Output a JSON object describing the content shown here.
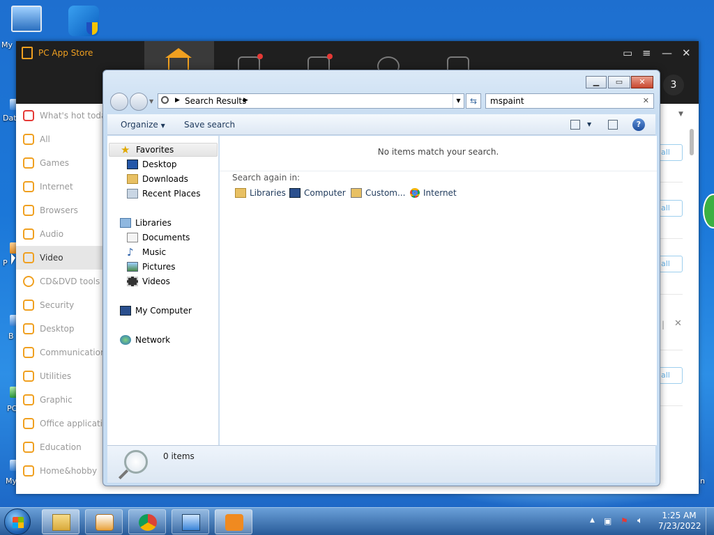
{
  "desktop": {
    "icon_my_computer_label": "My",
    "partial_labels": [
      "Dat",
      "P",
      "B",
      "PC",
      "My"
    ],
    "right_edge_label": "n"
  },
  "app_store": {
    "title": "PC App Store",
    "notification_count": "3",
    "sidebar": [
      {
        "label": "What's hot toda",
        "icon": "fire-icon"
      },
      {
        "label": "All",
        "icon": "bag-icon"
      },
      {
        "label": "Games",
        "icon": "gamepad-icon"
      },
      {
        "label": "Internet",
        "icon": "wifi-icon"
      },
      {
        "label": "Browsers",
        "icon": "browser-icon"
      },
      {
        "label": "Audio",
        "icon": "speaker-icon"
      },
      {
        "label": "Video",
        "icon": "video-icon",
        "active": true
      },
      {
        "label": "CD&DVD tools",
        "icon": "disc-icon"
      },
      {
        "label": "Security",
        "icon": "shield-icon"
      },
      {
        "label": "Desktop",
        "icon": "grid-icon"
      },
      {
        "label": "Communications",
        "icon": "chat-icon"
      },
      {
        "label": "Utilities",
        "icon": "tools-icon"
      },
      {
        "label": "Graphic",
        "icon": "camera-icon"
      },
      {
        "label": "Office application",
        "icon": "printer-icon"
      },
      {
        "label": "Education",
        "icon": "book-icon"
      },
      {
        "label": "Home&hobby",
        "icon": "home-icon"
      }
    ],
    "install_label_fragment": "all"
  },
  "explorer": {
    "address": {
      "crumb": "Search Results"
    },
    "search": {
      "value": "mspaint",
      "placeholder": ""
    },
    "toolbar": {
      "organize_label": "Organize",
      "save_search_label": "Save search"
    },
    "nav": {
      "favorites": "Favorites",
      "favorites_items": [
        "Desktop",
        "Downloads",
        "Recent Places"
      ],
      "libraries": "Libraries",
      "libraries_items": [
        "Documents",
        "Music",
        "Pictures",
        "Videos"
      ],
      "computer": "My Computer",
      "network": "Network"
    },
    "content": {
      "empty_message": "No items match your search.",
      "search_again_label": "Search again in:",
      "search_again_items": [
        "Libraries",
        "Computer",
        "Custom...",
        "Internet"
      ]
    },
    "details": {
      "count": "0 items"
    }
  },
  "taskbar": {
    "time": "1:25 AM",
    "date": "7/23/2022"
  },
  "colors": {
    "accent_orange": "#f0a020",
    "store_header": "#1f1f1f",
    "explorer_frame": "#c6dcf2",
    "desktop_blue": "#1b77d8"
  }
}
